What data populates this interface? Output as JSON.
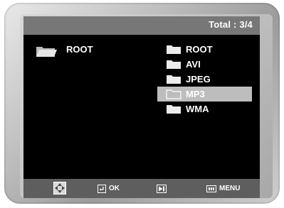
{
  "header": {
    "total_label": "Total : 3/4"
  },
  "current_folder": {
    "label": "ROOT",
    "icon": "open-folder-icon"
  },
  "folders": [
    {
      "label": "ROOT",
      "icon": "folder-icon",
      "selected": false
    },
    {
      "label": "AVI",
      "icon": "folder-icon",
      "selected": false
    },
    {
      "label": "JPEG",
      "icon": "folder-icon",
      "selected": false
    },
    {
      "label": "MP3",
      "icon": "folder-outline-icon",
      "selected": true
    },
    {
      "label": "WMA",
      "icon": "folder-icon",
      "selected": false
    }
  ],
  "footer": {
    "nav_icon": "directional-pad-icon",
    "ok_icon": "enter-icon",
    "ok_label": "OK",
    "next_icon": "skip-next-icon",
    "menu_icon": "menu-icon",
    "menu_label": "MENU"
  },
  "colors": {
    "header_bg": "#777777",
    "footer_bg": "#5e5e5e",
    "selection_bg": "#bdbdbd",
    "screen_bg": "#000000"
  }
}
